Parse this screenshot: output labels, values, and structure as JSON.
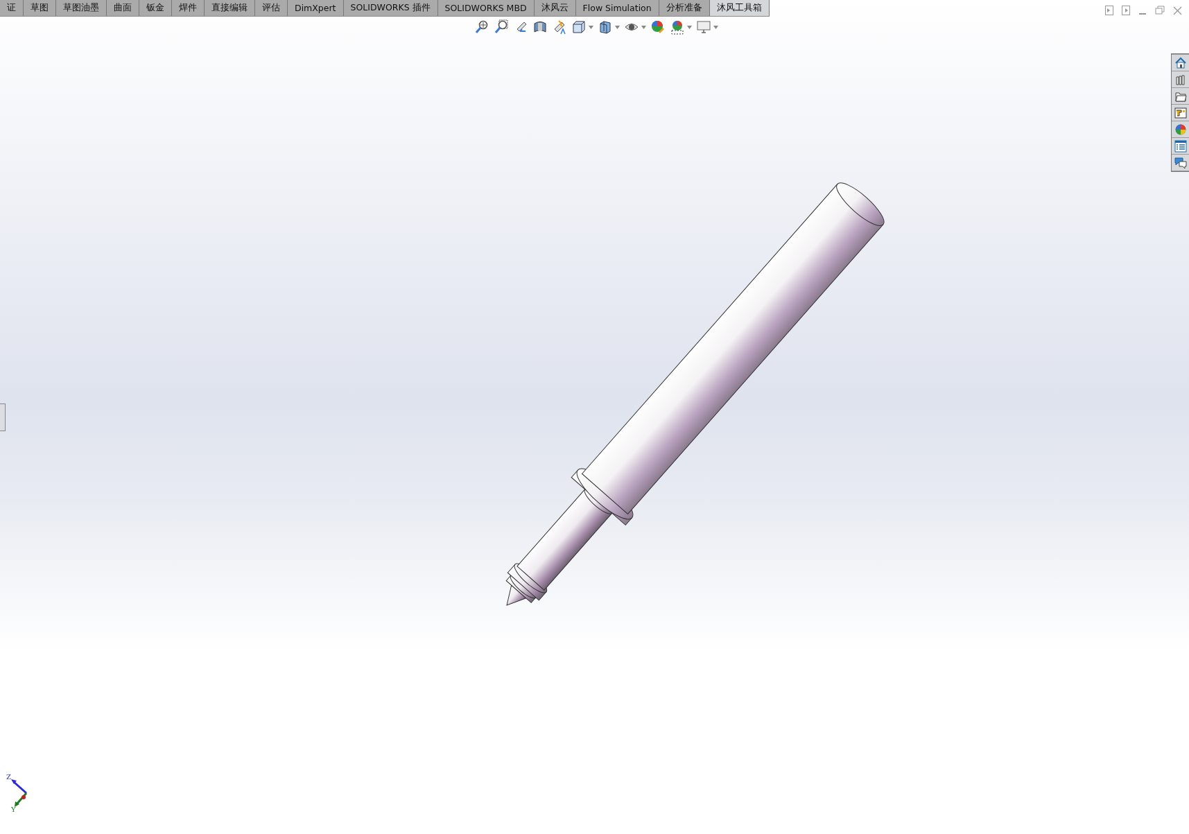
{
  "tabs": [
    {
      "label": "证",
      "selected": false
    },
    {
      "label": "草图",
      "selected": false
    },
    {
      "label": "草图油墨",
      "selected": false
    },
    {
      "label": "曲面",
      "selected": false
    },
    {
      "label": "钣金",
      "selected": false
    },
    {
      "label": "焊件",
      "selected": false
    },
    {
      "label": "直接编辑",
      "selected": false
    },
    {
      "label": "评估",
      "selected": false
    },
    {
      "label": "DimXpert",
      "selected": false
    },
    {
      "label": "SOLIDWORKS 插件",
      "selected": false
    },
    {
      "label": "SOLIDWORKS MBD",
      "selected": false
    },
    {
      "label": "沐风云",
      "selected": false
    },
    {
      "label": "Flow Simulation",
      "selected": false
    },
    {
      "label": "分析准备",
      "selected": false
    },
    {
      "label": "沐风工具箱",
      "selected": true
    }
  ],
  "triad": {
    "axes": [
      {
        "label": "Z"
      },
      {
        "label": "Y"
      }
    ]
  }
}
